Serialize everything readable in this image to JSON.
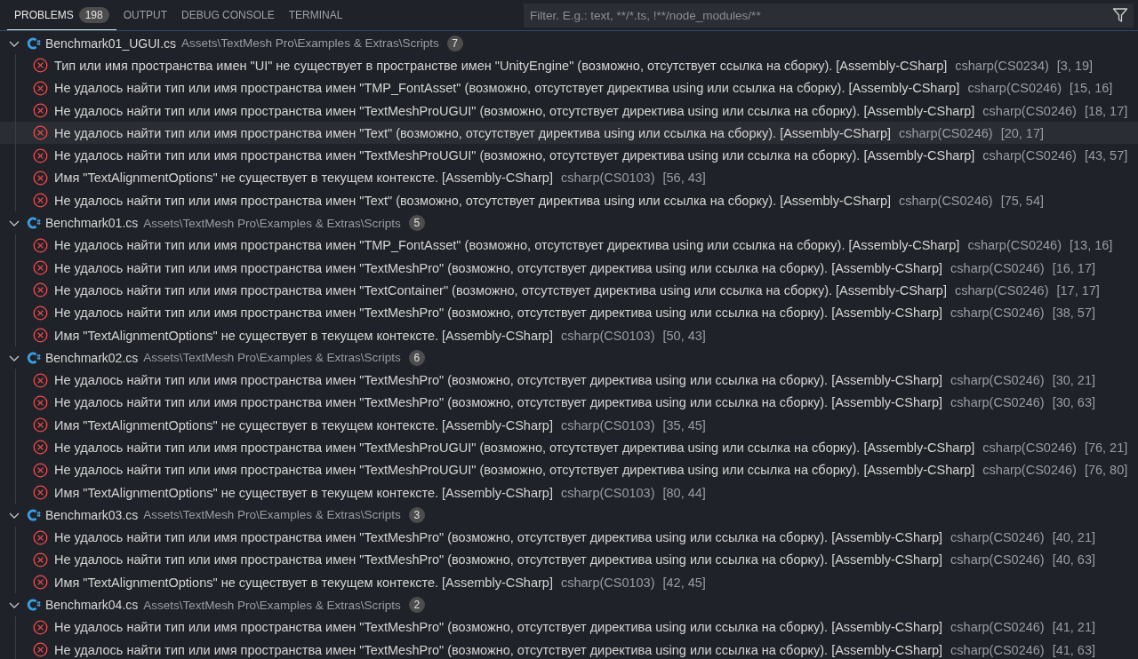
{
  "tabs": [
    {
      "label": "PROBLEMS",
      "badge": "198",
      "selected": true
    },
    {
      "label": "OUTPUT",
      "selected": false
    },
    {
      "label": "DEBUG CONSOLE",
      "selected": false
    },
    {
      "label": "TERMINAL",
      "selected": false
    }
  ],
  "filter": {
    "placeholder": "Filter. E.g.: text, **/*.ts, !**/node_modules/**"
  },
  "groups": [
    {
      "file": "Benchmark01_UGUI.cs",
      "path": "Assets\\TextMesh Pro\\Examples & Extras\\Scripts",
      "count": "7",
      "expanded": true,
      "problems": [
        {
          "message": "Тип или имя пространства имен \"UI\" не существует в пространстве имен \"UnityEngine\" (возможно, отсутствует ссылка на сборку). [Assembly-CSharp]",
          "code": "csharp(CS0234)",
          "position": "[3, 19]",
          "hovered": false
        },
        {
          "message": "Не удалось найти тип или имя пространства имен \"TMP_FontAsset\" (возможно, отсутствует директива using или ссылка на сборку). [Assembly-CSharp]",
          "code": "csharp(CS0246)",
          "position": "[15, 16]",
          "hovered": false
        },
        {
          "message": "Не удалось найти тип или имя пространства имен \"TextMeshProUGUI\" (возможно, отсутствует директива using или ссылка на сборку). [Assembly-CSharp]",
          "code": "csharp(CS0246)",
          "position": "[18, 17]",
          "hovered": false
        },
        {
          "message": "Не удалось найти тип или имя пространства имен \"Text\" (возможно, отсутствует директива using или ссылка на сборку). [Assembly-CSharp]",
          "code": "csharp(CS0246)",
          "position": "[20, 17]",
          "hovered": true
        },
        {
          "message": "Не удалось найти тип или имя пространства имен \"TextMeshProUGUI\" (возможно, отсутствует директива using или ссылка на сборку). [Assembly-CSharp]",
          "code": "csharp(CS0246)",
          "position": "[43, 57]",
          "hovered": false
        },
        {
          "message": "Имя \"TextAlignmentOptions\" не существует в текущем контексте. [Assembly-CSharp]",
          "code": "csharp(CS0103)",
          "position": "[56, 43]",
          "hovered": false
        },
        {
          "message": "Не удалось найти тип или имя пространства имен \"Text\" (возможно, отсутствует директива using или ссылка на сборку). [Assembly-CSharp]",
          "code": "csharp(CS0246)",
          "position": "[75, 54]",
          "hovered": false
        }
      ]
    },
    {
      "file": "Benchmark01.cs",
      "path": "Assets\\TextMesh Pro\\Examples & Extras\\Scripts",
      "count": "5",
      "expanded": true,
      "problems": [
        {
          "message": "Не удалось найти тип или имя пространства имен \"TMP_FontAsset\" (возможно, отсутствует директива using или ссылка на сборку). [Assembly-CSharp]",
          "code": "csharp(CS0246)",
          "position": "[13, 16]",
          "hovered": false
        },
        {
          "message": "Не удалось найти тип или имя пространства имен \"TextMeshPro\" (возможно, отсутствует директива using или ссылка на сборку). [Assembly-CSharp]",
          "code": "csharp(CS0246)",
          "position": "[16, 17]",
          "hovered": false
        },
        {
          "message": "Не удалось найти тип или имя пространства имен \"TextContainer\" (возможно, отсутствует директива using или ссылка на сборку). [Assembly-CSharp]",
          "code": "csharp(CS0246)",
          "position": "[17, 17]",
          "hovered": false
        },
        {
          "message": "Не удалось найти тип или имя пространства имен \"TextMeshPro\" (возможно, отсутствует директива using или ссылка на сборку). [Assembly-CSharp]",
          "code": "csharp(CS0246)",
          "position": "[38, 57]",
          "hovered": false
        },
        {
          "message": "Имя \"TextAlignmentOptions\" не существует в текущем контексте. [Assembly-CSharp]",
          "code": "csharp(CS0103)",
          "position": "[50, 43]",
          "hovered": false
        }
      ]
    },
    {
      "file": "Benchmark02.cs",
      "path": "Assets\\TextMesh Pro\\Examples & Extras\\Scripts",
      "count": "6",
      "expanded": true,
      "problems": [
        {
          "message": "Не удалось найти тип или имя пространства имен \"TextMeshPro\" (возможно, отсутствует директива using или ссылка на сборку). [Assembly-CSharp]",
          "code": "csharp(CS0246)",
          "position": "[30, 21]",
          "hovered": false
        },
        {
          "message": "Не удалось найти тип или имя пространства имен \"TextMeshPro\" (возможно, отсутствует директива using или ссылка на сборку). [Assembly-CSharp]",
          "code": "csharp(CS0246)",
          "position": "[30, 63]",
          "hovered": false
        },
        {
          "message": "Имя \"TextAlignmentOptions\" не существует в текущем контексте. [Assembly-CSharp]",
          "code": "csharp(CS0103)",
          "position": "[35, 45]",
          "hovered": false
        },
        {
          "message": "Не удалось найти тип или имя пространства имен \"TextMeshProUGUI\" (возможно, отсутствует директива using или ссылка на сборку). [Assembly-CSharp]",
          "code": "csharp(CS0246)",
          "position": "[76, 21]",
          "hovered": false
        },
        {
          "message": "Не удалось найти тип или имя пространства имен \"TextMeshProUGUI\" (возможно, отсутствует директива using или ссылка на сборку). [Assembly-CSharp]",
          "code": "csharp(CS0246)",
          "position": "[76, 80]",
          "hovered": false
        },
        {
          "message": "Имя \"TextAlignmentOptions\" не существует в текущем контексте. [Assembly-CSharp]",
          "code": "csharp(CS0103)",
          "position": "[80, 44]",
          "hovered": false
        }
      ]
    },
    {
      "file": "Benchmark03.cs",
      "path": "Assets\\TextMesh Pro\\Examples & Extras\\Scripts",
      "count": "3",
      "expanded": true,
      "problems": [
        {
          "message": "Не удалось найти тип или имя пространства имен \"TextMeshPro\" (возможно, отсутствует директива using или ссылка на сборку). [Assembly-CSharp]",
          "code": "csharp(CS0246)",
          "position": "[40, 21]",
          "hovered": false
        },
        {
          "message": "Не удалось найти тип или имя пространства имен \"TextMeshPro\" (возможно, отсутствует директива using или ссылка на сборку). [Assembly-CSharp]",
          "code": "csharp(CS0246)",
          "position": "[40, 63]",
          "hovered": false
        },
        {
          "message": "Имя \"TextAlignmentOptions\" не существует в текущем контексте. [Assembly-CSharp]",
          "code": "csharp(CS0103)",
          "position": "[42, 45]",
          "hovered": false
        }
      ]
    },
    {
      "file": "Benchmark04.cs",
      "path": "Assets\\TextMesh Pro\\Examples & Extras\\Scripts",
      "count": "2",
      "expanded": true,
      "problems": [
        {
          "message": "Не удалось найти тип или имя пространства имен \"TextMeshPro\" (возможно, отсутствует директива using или ссылка на сборку). [Assembly-CSharp]",
          "code": "csharp(CS0246)",
          "position": "[41, 21]",
          "hovered": false
        },
        {
          "message": "Не удалось найти тип или имя пространства имен \"TextMeshPro\" (возможно, отсутствует директива using или ссылка на сборку). [Assembly-CSharp]",
          "code": "csharp(CS0246)",
          "position": "[41, 63]",
          "hovered": false
        }
      ]
    }
  ]
}
